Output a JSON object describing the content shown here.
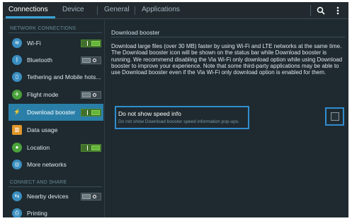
{
  "tabs": [
    "Connections",
    "Device",
    "General",
    "Applications"
  ],
  "sections": {
    "network": "NETWORK CONNECTIONS",
    "connect": "CONNECT AND SHARE"
  },
  "items": [
    {
      "label": "Wi-Fi",
      "icon": "wifi-icon",
      "toggle": "on"
    },
    {
      "label": "Bluetooth",
      "icon": "bluetooth-icon",
      "toggle": "off"
    },
    {
      "label": "Tethering and Mobile hots...",
      "icon": "tethering-icon",
      "toggle": null
    },
    {
      "label": "Flight mode",
      "icon": "airplane-icon",
      "toggle": "off"
    },
    {
      "label": "Download booster",
      "icon": "download-booster-icon",
      "toggle": "on"
    },
    {
      "label": "Data usage",
      "icon": "data-usage-icon",
      "toggle": null
    },
    {
      "label": "Location",
      "icon": "location-icon",
      "toggle": "on"
    },
    {
      "label": "More networks",
      "icon": "more-networks-icon",
      "toggle": null
    },
    {
      "label": "Nearby devices",
      "icon": "nearby-devices-icon",
      "toggle": "off"
    },
    {
      "label": "Printing",
      "icon": "printer-icon",
      "toggle": null
    }
  ],
  "main": {
    "title": "Download booster",
    "description": "Download large files (over 30 MB) faster by using Wi-Fi and LTE networks at the same time. The Download booster icon will be shown on the status bar while Download booster is running. We recommend disabling the Via Wi-Fi only download option while using Download booster to improve your experience. Note that some third-party applications may be able to use Download booster even if the Via Wi-Fi only download option is enabled for them.",
    "option_title": "Do not show speed info",
    "option_subtitle": "Do not show Download booster speed information pop-ups."
  },
  "colors": {
    "accent": "#2f8dd0",
    "selected": "#2a7fa8",
    "toggle_on": "#64b53a",
    "background": "#1f2a30"
  }
}
